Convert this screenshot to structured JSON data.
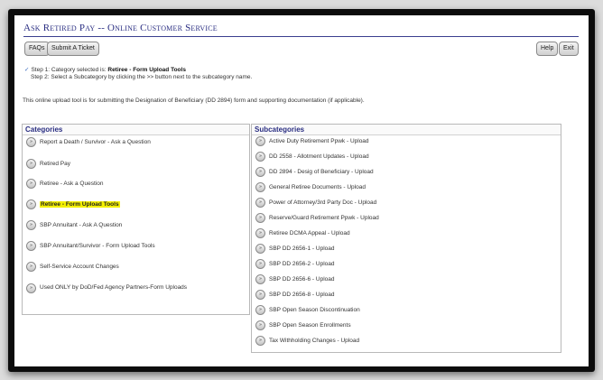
{
  "title": "Ask Retired Pay -- Online Customer Service",
  "toolbar": {
    "faqs_label": "FAQs",
    "submit_label": "Submit A Ticket",
    "help_label": "Help",
    "exit_label": "Exit"
  },
  "steps": {
    "step1_prefix": "Step 1: Category selected is:",
    "step1_value": "Retiree - Form Upload Tools",
    "step2": "Step 2: Select a Subcategory by clicking the >> button next to the subcategory name."
  },
  "intro": "This online upload tool is for submitting the Designation of Beneficiary (DD 2894) form and supporting documentation (if applicable).",
  "categories": {
    "header": "Categories",
    "items": [
      "Report a Death / Survivor - Ask a Question",
      "Retired Pay",
      "Retiree - Ask a Question",
      "Retiree - Form Upload Tools",
      "SBP Annuitant - Ask A Question",
      "SBP Annuitant/Survivor - Form Upload Tools",
      "Self-Service Account Changes",
      "Used ONLY by DoD/Fed Agency Partners-Form Uploads"
    ],
    "selected_index": 3
  },
  "subcategories": {
    "header": "Subcategories",
    "items": [
      "Active Duty Retirement Ppwk - Upload",
      "DD 2558 - Allotment Updates - Upload",
      "DD 2894 - Desig of Beneficiary - Upload",
      "General Retiree Documents - Upload",
      "Power of Attorney/3rd Party Doc - Upload",
      "Reserve/Guard Retirement Ppwk - Upload",
      "Retiree DCMA Appeal - Upload",
      "SBP DD 2656-1 - Upload",
      "SBP DD 2656-2 - Upload",
      "SBP DD 2656-6 - Upload",
      "SBP DD 2656-8 - Upload",
      "SBP Open Season Discontinuation",
      "SBP Open Season Enrollments",
      "Tax Withholding Changes - Upload"
    ]
  },
  "icons": {
    "expand": "double-chevron-right-icon",
    "step": "check-icon"
  },
  "colors": {
    "title": "#2a2e82",
    "highlight": "#f4f000",
    "frame": "#0c0c0c"
  }
}
